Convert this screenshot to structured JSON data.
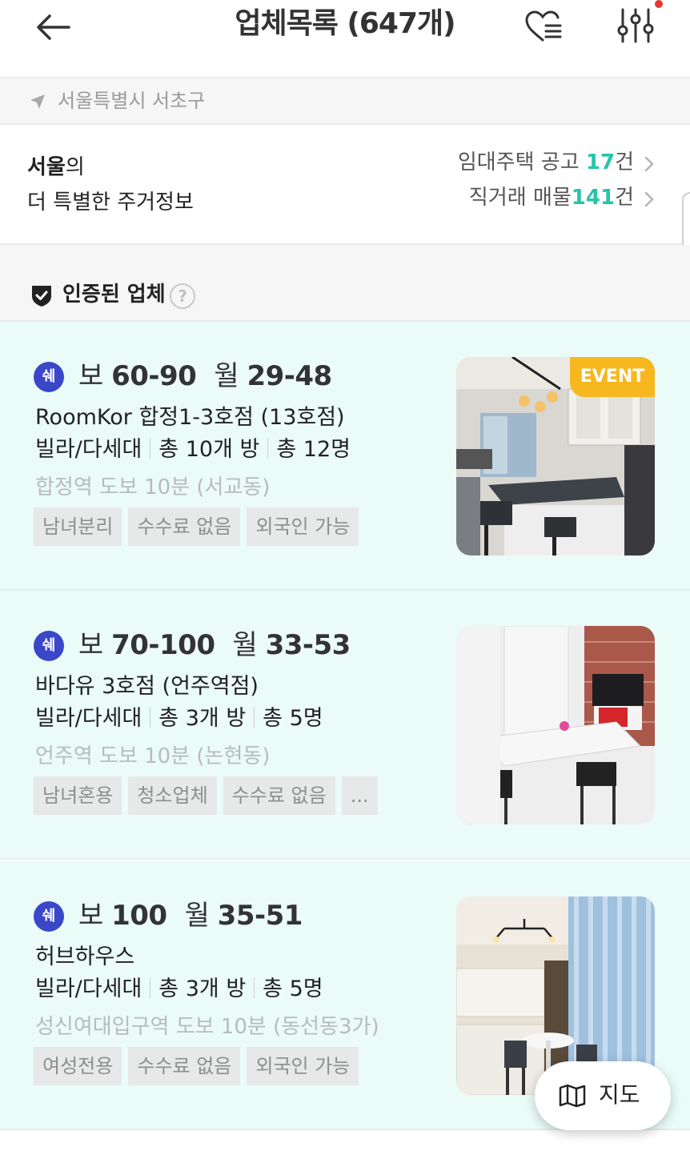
{
  "header": {
    "title": "업체목록 (647개)"
  },
  "location": {
    "text": "서울특별시 서초구"
  },
  "info": {
    "city": "서울",
    "city_suffix": "의",
    "subtitle": "더 특별한 주거정보",
    "rental_label": "임대주택 공고 ",
    "rental_count": "17",
    "rental_unit": "건",
    "direct_label": "직거래 매물",
    "direct_count": "141",
    "direct_unit": "건"
  },
  "verified": {
    "label": "인증된 업체",
    "help": "?"
  },
  "listings": [
    {
      "badge": "쉐",
      "deposit_label": "보 ",
      "deposit": "60-90",
      "monthly_label": "월 ",
      "monthly": "29-48",
      "name": "RoomKor 합정1-3호점 (13호점)",
      "type": "빌라/다세대",
      "rooms": "총 10개 방",
      "people": "총 12명",
      "location": "합정역 도보 10분 (서교동)",
      "tags": [
        "남녀분리",
        "수수료 없음",
        "외국인 가능"
      ],
      "event": "EVENT"
    },
    {
      "badge": "쉐",
      "deposit_label": "보 ",
      "deposit": "70-100",
      "monthly_label": "월 ",
      "monthly": "33-53",
      "name": "바다유 3호점 (언주역점)",
      "type": "빌라/다세대",
      "rooms": "총 3개 방",
      "people": "총 5명",
      "location": "언주역 도보 10분 (논현동)",
      "tags": [
        "남녀혼용",
        "청소업체",
        "수수료 없음",
        "..."
      ]
    },
    {
      "badge": "쉐",
      "deposit_label": "보 ",
      "deposit": "100",
      "monthly_label": "월 ",
      "monthly": "35-51",
      "name": "허브하우스",
      "type": "빌라/다세대",
      "rooms": "총 3개 방",
      "people": "총 5명",
      "location": "성신여대입구역 도보 10분 (동선동3가)",
      "tags": [
        "여성전용",
        "수수료 없음",
        "외국인 가능"
      ]
    }
  ],
  "map_button": {
    "label": "지도"
  },
  "colors": {
    "accent": "#25c4a8",
    "badge": "#3b47c9",
    "event": "#f6b81e",
    "card_bg": "#eafbf8"
  }
}
